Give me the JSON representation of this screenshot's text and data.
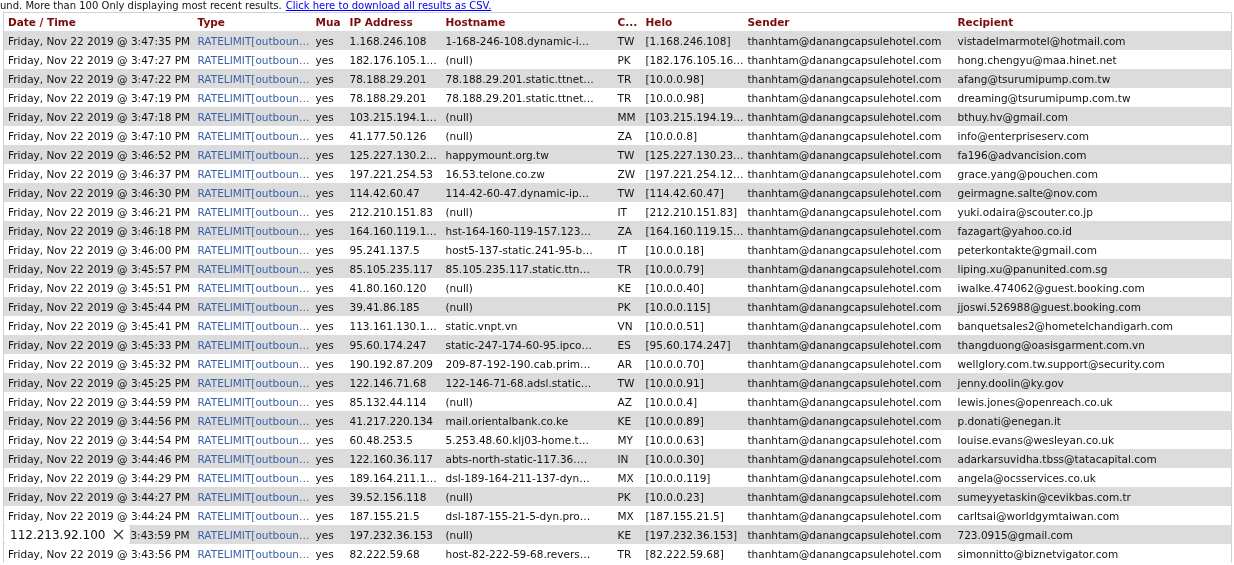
{
  "notice": {
    "text": "und. More than 100 Only displaying most recent results.",
    "link": "Click here to download all results as CSV."
  },
  "table": {
    "columns": [
      "Date / Time",
      "Type",
      "Mua",
      "IP Address",
      "Hostname",
      "C...",
      "Helo",
      "Sender",
      "Recipient"
    ],
    "rows": [
      {
        "date": "Friday, Nov 22 2019 @ 3:47:35 PM",
        "type": "RATELIMIT[outboun…",
        "mua": "yes",
        "ip": "1.168.246.108",
        "hostname": "1-168-246-108.dynamic-i…",
        "country": "TW",
        "helo": "[1.168.246.108]",
        "sender": "thanhtam@danangcapsulehotel.com",
        "recipient": "vistadelmarmotel@hotmail.com"
      },
      {
        "date": "Friday, Nov 22 2019 @ 3:47:27 PM",
        "type": "RATELIMIT[outboun…",
        "mua": "yes",
        "ip": "182.176.105.1…",
        "hostname": "(null)",
        "country": "PK",
        "helo": "[182.176.105.16…",
        "sender": "thanhtam@danangcapsulehotel.com",
        "recipient": "hong.chengyu@maa.hinet.net"
      },
      {
        "date": "Friday, Nov 22 2019 @ 3:47:22 PM",
        "type": "RATELIMIT[outboun…",
        "mua": "yes",
        "ip": "78.188.29.201",
        "hostname": "78.188.29.201.static.ttnet…",
        "country": "TR",
        "helo": "[10.0.0.98]",
        "sender": "thanhtam@danangcapsulehotel.com",
        "recipient": "afang@tsurumipump.com.tw"
      },
      {
        "date": "Friday, Nov 22 2019 @ 3:47:19 PM",
        "type": "RATELIMIT[outboun…",
        "mua": "yes",
        "ip": "78.188.29.201",
        "hostname": "78.188.29.201.static.ttnet…",
        "country": "TR",
        "helo": "[10.0.0.98]",
        "sender": "thanhtam@danangcapsulehotel.com",
        "recipient": "dreaming@tsurumipump.com.tw"
      },
      {
        "date": "Friday, Nov 22 2019 @ 3:47:18 PM",
        "type": "RATELIMIT[outboun…",
        "mua": "yes",
        "ip": "103.215.194.1…",
        "hostname": "(null)",
        "country": "MM",
        "helo": "[103.215.194.19…",
        "sender": "thanhtam@danangcapsulehotel.com",
        "recipient": "bthuy.hv@gmail.com"
      },
      {
        "date": "Friday, Nov 22 2019 @ 3:47:10 PM",
        "type": "RATELIMIT[outboun…",
        "mua": "yes",
        "ip": "41.177.50.126",
        "hostname": "(null)",
        "country": "ZA",
        "helo": "[10.0.0.8]",
        "sender": "thanhtam@danangcapsulehotel.com",
        "recipient": "info@enterpriseserv.com"
      },
      {
        "date": "Friday, Nov 22 2019 @ 3:46:52 PM",
        "type": "RATELIMIT[outboun…",
        "mua": "yes",
        "ip": "125.227.130.2…",
        "hostname": "happymount.org.tw",
        "country": "TW",
        "helo": "[125.227.130.23…",
        "sender": "thanhtam@danangcapsulehotel.com",
        "recipient": "fa196@advancision.com"
      },
      {
        "date": "Friday, Nov 22 2019 @ 3:46:37 PM",
        "type": "RATELIMIT[outboun…",
        "mua": "yes",
        "ip": "197.221.254.53",
        "hostname": "16.53.telone.co.zw",
        "country": "ZW",
        "helo": "[197.221.254.12…",
        "sender": "thanhtam@danangcapsulehotel.com",
        "recipient": "grace.yang@pouchen.com"
      },
      {
        "date": "Friday, Nov 22 2019 @ 3:46:30 PM",
        "type": "RATELIMIT[outboun…",
        "mua": "yes",
        "ip": "114.42.60.47",
        "hostname": "114-42-60-47.dynamic-ip…",
        "country": "TW",
        "helo": "[114.42.60.47]",
        "sender": "thanhtam@danangcapsulehotel.com",
        "recipient": "geirmagne.salte@nov.com"
      },
      {
        "date": "Friday, Nov 22 2019 @ 3:46:21 PM",
        "type": "RATELIMIT[outboun…",
        "mua": "yes",
        "ip": "212.210.151.83",
        "hostname": "(null)",
        "country": "IT",
        "helo": "[212.210.151.83]",
        "sender": "thanhtam@danangcapsulehotel.com",
        "recipient": "yuki.odaira@scouter.co.jp"
      },
      {
        "date": "Friday, Nov 22 2019 @ 3:46:18 PM",
        "type": "RATELIMIT[outboun…",
        "mua": "yes",
        "ip": "164.160.119.1…",
        "hostname": "hst-164-160-119-157.123…",
        "country": "ZA",
        "helo": "[164.160.119.15…",
        "sender": "thanhtam@danangcapsulehotel.com",
        "recipient": "fazagart@yahoo.co.id"
      },
      {
        "date": "Friday, Nov 22 2019 @ 3:46:00 PM",
        "type": "RATELIMIT[outboun…",
        "mua": "yes",
        "ip": "95.241.137.5",
        "hostname": "host5-137-static.241-95-b…",
        "country": "IT",
        "helo": "[10.0.0.18]",
        "sender": "thanhtam@danangcapsulehotel.com",
        "recipient": "peterkontakte@gmail.com"
      },
      {
        "date": "Friday, Nov 22 2019 @ 3:45:57 PM",
        "type": "RATELIMIT[outboun…",
        "mua": "yes",
        "ip": "85.105.235.117",
        "hostname": "85.105.235.117.static.ttn…",
        "country": "TR",
        "helo": "[10.0.0.79]",
        "sender": "thanhtam@danangcapsulehotel.com",
        "recipient": "liping.xu@panunited.com.sg"
      },
      {
        "date": "Friday, Nov 22 2019 @ 3:45:51 PM",
        "type": "RATELIMIT[outboun…",
        "mua": "yes",
        "ip": "41.80.160.120",
        "hostname": "(null)",
        "country": "KE",
        "helo": "[10.0.0.40]",
        "sender": "thanhtam@danangcapsulehotel.com",
        "recipient": "iwalke.474062@guest.booking.com"
      },
      {
        "date": "Friday, Nov 22 2019 @ 3:45:44 PM",
        "type": "RATELIMIT[outboun…",
        "mua": "yes",
        "ip": "39.41.86.185",
        "hostname": "(null)",
        "country": "PK",
        "helo": "[10.0.0.115]",
        "sender": "thanhtam@danangcapsulehotel.com",
        "recipient": "jjoswi.526988@guest.booking.com"
      },
      {
        "date": "Friday, Nov 22 2019 @ 3:45:41 PM",
        "type": "RATELIMIT[outboun…",
        "mua": "yes",
        "ip": "113.161.130.1…",
        "hostname": "static.vnpt.vn",
        "country": "VN",
        "helo": "[10.0.0.51]",
        "sender": "thanhtam@danangcapsulehotel.com",
        "recipient": "banquetsales2@hometelchandigarh.com"
      },
      {
        "date": "Friday, Nov 22 2019 @ 3:45:33 PM",
        "type": "RATELIMIT[outboun…",
        "mua": "yes",
        "ip": "95.60.174.247",
        "hostname": "static-247-174-60-95.ipco…",
        "country": "ES",
        "helo": "[95.60.174.247]",
        "sender": "thanhtam@danangcapsulehotel.com",
        "recipient": "thangduong@oasisgarment.com.vn"
      },
      {
        "date": "Friday, Nov 22 2019 @ 3:45:32 PM",
        "type": "RATELIMIT[outboun…",
        "mua": "yes",
        "ip": "190.192.87.209",
        "hostname": "209-87-192-190.cab.prim…",
        "country": "AR",
        "helo": "[10.0.0.70]",
        "sender": "thanhtam@danangcapsulehotel.com",
        "recipient": "wellglory.com.tw.support@security.com"
      },
      {
        "date": "Friday, Nov 22 2019 @ 3:45:25 PM",
        "type": "RATELIMIT[outboun…",
        "mua": "yes",
        "ip": "122.146.71.68",
        "hostname": "122-146-71-68.adsl.static…",
        "country": "TW",
        "helo": "[10.0.0.91]",
        "sender": "thanhtam@danangcapsulehotel.com",
        "recipient": "jenny.doolin@ky.gov"
      },
      {
        "date": "Friday, Nov 22 2019 @ 3:44:59 PM",
        "type": "RATELIMIT[outboun…",
        "mua": "yes",
        "ip": "85.132.44.114",
        "hostname": "(null)",
        "country": "AZ",
        "helo": "[10.0.0.4]",
        "sender": "thanhtam@danangcapsulehotel.com",
        "recipient": "lewis.jones@openreach.co.uk"
      },
      {
        "date": "Friday, Nov 22 2019 @ 3:44:56 PM",
        "type": "RATELIMIT[outboun…",
        "mua": "yes",
        "ip": "41.217.220.134",
        "hostname": "mail.orientalbank.co.ke",
        "country": "KE",
        "helo": "[10.0.0.89]",
        "sender": "thanhtam@danangcapsulehotel.com",
        "recipient": "p.donati@enegan.it"
      },
      {
        "date": "Friday, Nov 22 2019 @ 3:44:54 PM",
        "type": "RATELIMIT[outboun…",
        "mua": "yes",
        "ip": "60.48.253.5",
        "hostname": "5.253.48.60.klj03-home.t…",
        "country": "MY",
        "helo": "[10.0.0.63]",
        "sender": "thanhtam@danangcapsulehotel.com",
        "recipient": "louise.evans@wesleyan.co.uk"
      },
      {
        "date": "Friday, Nov 22 2019 @ 3:44:46 PM",
        "type": "RATELIMIT[outboun…",
        "mua": "yes",
        "ip": "122.160.36.117",
        "hostname": "abts-north-static-117.36.…",
        "country": "IN",
        "helo": "[10.0.0.30]",
        "sender": "thanhtam@danangcapsulehotel.com",
        "recipient": "adarkarsuvidha.tbss@tatacapital.com"
      },
      {
        "date": "Friday, Nov 22 2019 @ 3:44:29 PM",
        "type": "RATELIMIT[outboun…",
        "mua": "yes",
        "ip": "189.164.211.1…",
        "hostname": "dsl-189-164-211-137-dyn…",
        "country": "MX",
        "helo": "[10.0.0.119]",
        "sender": "thanhtam@danangcapsulehotel.com",
        "recipient": "angela@ocsservices.co.uk"
      },
      {
        "date": "Friday, Nov 22 2019 @ 3:44:27 PM",
        "type": "RATELIMIT[outboun…",
        "mua": "yes",
        "ip": "39.52.156.118",
        "hostname": "(null)",
        "country": "PK",
        "helo": "[10.0.0.23]",
        "sender": "thanhtam@danangcapsulehotel.com",
        "recipient": "sumeyyetaskin@cevikbas.com.tr"
      },
      {
        "date": "Friday, Nov 22 2019 @ 3:44:24 PM",
        "type": "RATELIMIT[outboun…",
        "mua": "yes",
        "ip": "187.155.21.5",
        "hostname": "dsl-187-155-21-5-dyn.pro…",
        "country": "MX",
        "helo": "[187.155.21.5]",
        "sender": "thanhtam@danangcapsulehotel.com",
        "recipient": "carltsai@worldgymtaiwan.com"
      },
      {
        "date": "3:43:59 PM",
        "covered": true,
        "type": "RATELIMIT[outboun…",
        "mua": "yes",
        "ip": "197.232.36.153",
        "hostname": "(null)",
        "country": "KE",
        "helo": "[197.232.36.153]",
        "sender": "thanhtam@danangcapsulehotel.com",
        "recipient": "723.0915@gmail.com"
      },
      {
        "date": "Friday, Nov 22 2019 @ 3:43:56 PM",
        "type": "RATELIMIT[outboun…",
        "mua": "yes",
        "ip": "82.222.59.68",
        "hostname": "host-82-222-59-68.revers…",
        "country": "TR",
        "helo": "[82.222.59.68]",
        "sender": "thanhtam@danangcapsulehotel.com",
        "recipient": "simonnitto@biznetvigator.com"
      }
    ]
  },
  "find_popup": {
    "text": "112.213.92.100"
  }
}
